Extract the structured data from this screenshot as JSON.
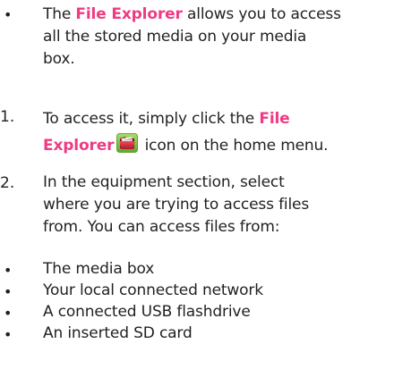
{
  "intro": {
    "bullet": "•",
    "line1_pre": "The ",
    "line1_highlight": "File Explorer",
    "line1_post": " allows you to access",
    "line2": "all the stored media on your media",
    "line3": "box."
  },
  "steps": [
    {
      "number": "1.",
      "line1_pre": "To access it, simply click the ",
      "line1_highlight": "File",
      "line2_highlight": "Explorer",
      "icon": "file-explorer-icon",
      "line2_post": " icon on the home menu."
    },
    {
      "number": "2.",
      "line1": "In the equipment section, select",
      "line2": "where you are trying to access files",
      "line3": "from. You can access files from:"
    }
  ],
  "sources": [
    {
      "bullet": "•",
      "label": "The media box"
    },
    {
      "bullet": "•",
      "label": "Your local connected network"
    },
    {
      "bullet": "•",
      "label": "A connected USB flashdrive"
    },
    {
      "bullet": "•",
      "label": "An inserted SD card"
    }
  ],
  "colors": {
    "text": "#231f20",
    "highlight": "#ee3b84",
    "icon_green": "#7cc242",
    "icon_red": "#c8202f"
  }
}
